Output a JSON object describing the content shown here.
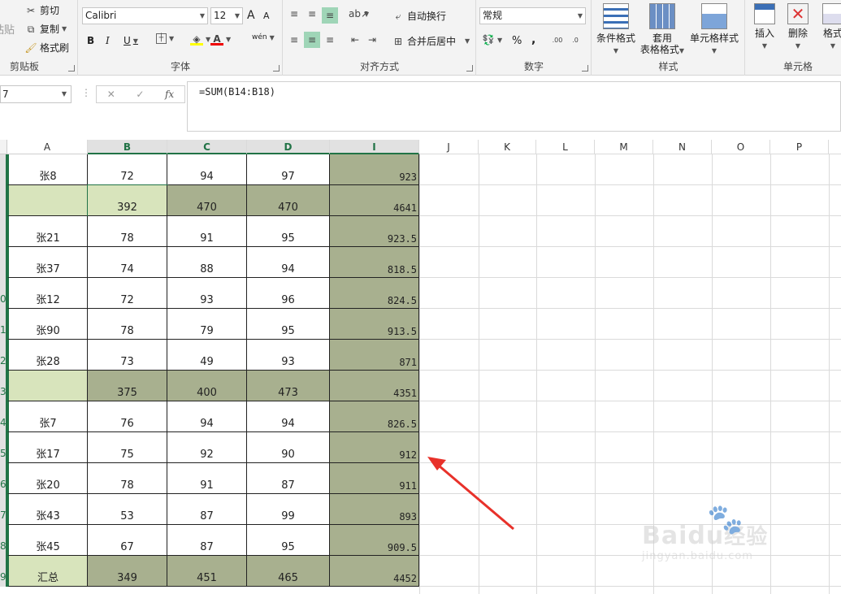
{
  "ribbon": {
    "clipboard": {
      "paste_label": "粘贴",
      "cut_label": "剪切",
      "copy_label": "复制",
      "format_painter_label": "格式刷",
      "group_label": "剪贴板"
    },
    "font": {
      "font_name": "Calibri",
      "font_size": "12",
      "bold": "B",
      "italic": "I",
      "underline": "U",
      "phonetic": "wén",
      "group_label": "字体",
      "grow_font": "A",
      "shrink_font": "A"
    },
    "alignment": {
      "wrap_text_label": "自动换行",
      "merge_center_label": "合并后居中",
      "group_label": "对齐方式"
    },
    "number": {
      "format_value": "常规",
      "percent": "%",
      "comma": ",",
      "group_label": "数字"
    },
    "styles": {
      "conditional_label": "条件格式",
      "table_format_label_1": "套用",
      "table_format_label_2": "表格格式",
      "cell_styles_label": "单元格样式",
      "group_label": "样式"
    },
    "cells": {
      "insert_label": "插入",
      "delete_label": "删除",
      "format_label": "格式",
      "group_label": "单元格"
    }
  },
  "formula_bar": {
    "name_box": "7",
    "formula": "=SUM(B14:B18)",
    "fx": "fx"
  },
  "columns": [
    "A",
    "B",
    "C",
    "D",
    "I",
    "J",
    "K",
    "L",
    "M",
    "N",
    "O",
    "P"
  ],
  "rows": [
    {
      "num": "",
      "name": "张8",
      "b": "72",
      "c": "94",
      "d": "97",
      "i": "923",
      "style": "normal"
    },
    {
      "num": "",
      "name": "",
      "b": "392",
      "c": "470",
      "d": "470",
      "i": "4641",
      "style": "subtotal"
    },
    {
      "num": "",
      "name": "张21",
      "b": "78",
      "c": "91",
      "d": "95",
      "i": "923.5",
      "style": "normal"
    },
    {
      "num": "",
      "name": "张37",
      "b": "74",
      "c": "88",
      "d": "94",
      "i": "818.5",
      "style": "normal"
    },
    {
      "num": "0",
      "name": "张12",
      "b": "72",
      "c": "93",
      "d": "96",
      "i": "824.5",
      "style": "normal"
    },
    {
      "num": "1",
      "name": "张90",
      "b": "78",
      "c": "79",
      "d": "95",
      "i": "913.5",
      "style": "normal"
    },
    {
      "num": "2",
      "name": "张28",
      "b": "73",
      "c": "49",
      "d": "93",
      "i": "871",
      "style": "normal"
    },
    {
      "num": "3",
      "name": "",
      "b": "375",
      "c": "400",
      "d": "473",
      "i": "4351",
      "style": "subtotal"
    },
    {
      "num": "4",
      "name": "张7",
      "b": "76",
      "c": "94",
      "d": "94",
      "i": "826.5",
      "style": "normal"
    },
    {
      "num": "5",
      "name": "张17",
      "b": "75",
      "c": "92",
      "d": "90",
      "i": "912",
      "style": "normal"
    },
    {
      "num": "6",
      "name": "张20",
      "b": "78",
      "c": "91",
      "d": "87",
      "i": "911",
      "style": "normal"
    },
    {
      "num": "7",
      "name": "张43",
      "b": "53",
      "c": "87",
      "d": "99",
      "i": "893",
      "style": "normal"
    },
    {
      "num": "8",
      "name": "张45",
      "b": "67",
      "c": "87",
      "d": "95",
      "i": "909.5",
      "style": "normal"
    },
    {
      "num": "9",
      "name": "汇总",
      "b": "349",
      "c": "451",
      "d": "465",
      "i": "4452",
      "style": "total"
    }
  ],
  "watermark": {
    "text_1": "Bai",
    "text_2": "du",
    "text_3": "经验",
    "url": "jingyan.baidu.com"
  },
  "colors": {
    "dark_green_fill": "#a8b08f",
    "light_green_fill": "#d8e4bc",
    "excel_green": "#217346",
    "arrow_red": "#e8312a"
  }
}
